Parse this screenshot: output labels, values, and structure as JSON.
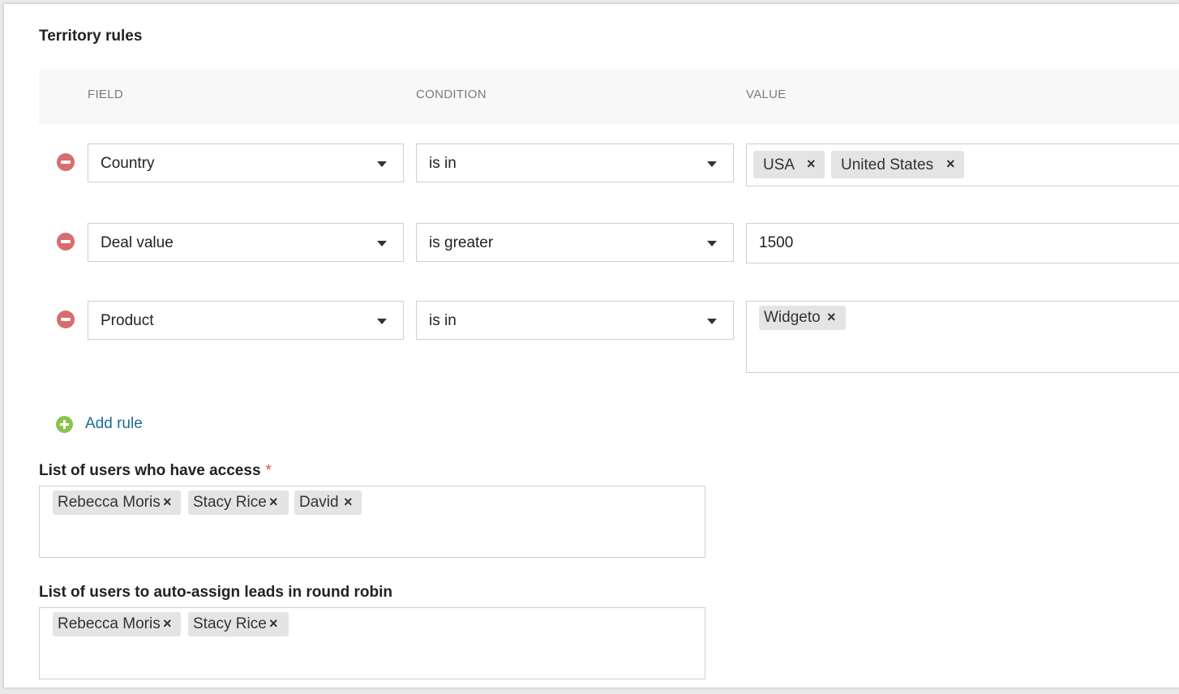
{
  "section_title": "Territory rules",
  "columns": {
    "field": "FIELD",
    "condition": "CONDITION",
    "value": "VALUE"
  },
  "rules": [
    {
      "field": "Country",
      "condition": "is in",
      "value_chips": [
        "USA",
        "United States"
      ]
    },
    {
      "field": "Deal value",
      "condition": "is greater",
      "value_text": "1500"
    },
    {
      "field": "Product",
      "condition": "is in",
      "value_chips": [
        "Widgeto"
      ]
    }
  ],
  "chip_remove_glyph": "×",
  "add_rule_label": "Add rule",
  "access_users": {
    "label": "List of users who have access",
    "required_mark": "*",
    "users": [
      "Rebecca Moris",
      "Stacy Rice",
      "David"
    ]
  },
  "round_robin_users": {
    "label": "List of users to auto-assign leads in round robin",
    "users": [
      "Rebecca Moris",
      "Stacy Rice"
    ]
  },
  "colors": {
    "remove": "#d76d6d",
    "add": "#8bc34a",
    "link": "#1d6a96",
    "required": "#d9534f",
    "chip": "#e4e4e4"
  },
  "icons": {
    "remove_rule": "minus-circle-icon",
    "add_rule": "plus-circle-icon",
    "dropdown": "caret-down-icon",
    "chip_remove": "close-icon"
  }
}
